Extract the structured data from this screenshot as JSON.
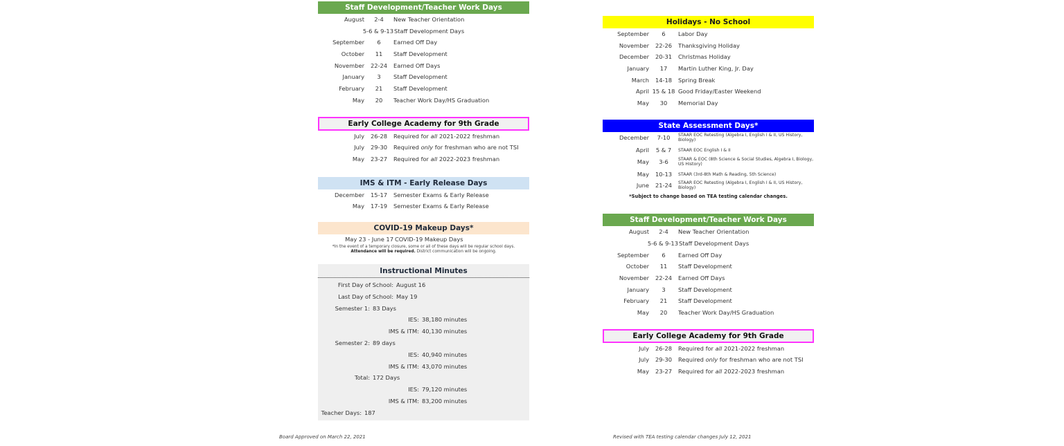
{
  "left_column": {
    "staff_development": {
      "title": "Staff Development/Teacher Work Days",
      "rows": [
        {
          "month": "August",
          "dates": "2-4",
          "event": "New Teacher Orientation"
        },
        {
          "month": "",
          "dates": "5-6 & 9-13",
          "event": "Staff Development Days"
        },
        {
          "month": "September",
          "dates": "6",
          "event": "Earned Off Day"
        },
        {
          "month": "October",
          "dates": "11",
          "event": "Staff Development"
        },
        {
          "month": "November",
          "dates": "22-24",
          "event": "Earned Off Days"
        },
        {
          "month": "January",
          "dates": "3",
          "event": "Staff Development"
        },
        {
          "month": "February",
          "dates": "21",
          "event": "Staff Development"
        },
        {
          "month": "May",
          "dates": "20",
          "event": "Teacher Work Day/HS Graduation"
        }
      ]
    },
    "early_college": {
      "title": "Early College Academy for 9th Grade",
      "rows": [
        {
          "month": "July",
          "dates": "26-28",
          "event_pre": "Required for ",
          "event_em": "all",
          "event_post": " 2021-2022 freshman"
        },
        {
          "month": "July",
          "dates": "29-30",
          "event_pre": "Required ",
          "event_em": "only",
          "event_post": " for freshman who are not TSI"
        },
        {
          "month": "May",
          "dates": "23-27",
          "event_pre": "Required for ",
          "event_em": "all",
          "event_post": " 2022-2023 freshman"
        }
      ]
    },
    "early_release": {
      "title": "IMS & ITM - Early Release Days",
      "rows": [
        {
          "month": "December",
          "dates": "15-17",
          "event": "Semester Exams & Early Release"
        },
        {
          "month": "May",
          "dates": "17-19",
          "event": "Semester Exams & Early Release"
        }
      ]
    },
    "covid": {
      "title": "COVID-19 Makeup Days*",
      "range": "May 23 - June 17",
      "event": "COVID-19 Makeup Days",
      "note_line1": "*In the event of a temporary closure, some or all of these days will be regular school days.",
      "note_bold": "Attendance will be required.",
      "note_line2": " District communication will be ongoing."
    },
    "instructional_minutes": {
      "title": "Instructional Minutes",
      "rows": [
        {
          "label": "First Day of School:",
          "value": "August 16",
          "indent": 1
        },
        {
          "label": "Last Day of School:",
          "value": "May 19",
          "indent": 1
        },
        {
          "label": "Semester 1:",
          "value": "83 Days",
          "indent": 0
        },
        {
          "label": "IES:",
          "value": "38,180 minutes",
          "indent": 2
        },
        {
          "label": "IMS & ITM:",
          "value": "40,130 minutes",
          "indent": 2
        },
        {
          "label": "Semester 2:",
          "value": "89 days",
          "indent": 0
        },
        {
          "label": "IES:",
          "value": "40,940 minutes",
          "indent": 2
        },
        {
          "label": "IMS & ITM:",
          "value": "43,070 minutes",
          "indent": 2
        },
        {
          "label": "Total:",
          "value": "172 Days",
          "indent": 3
        },
        {
          "label": "IES:",
          "value": "79,120 minutes",
          "indent": 2
        },
        {
          "label": "IMS & ITM:",
          "value": "83,200 minutes",
          "indent": 2
        },
        {
          "label": "Teacher Days:",
          "value": "187",
          "indent": 4
        }
      ]
    },
    "footer": "Board Approved on March 22, 2021"
  },
  "right_column": {
    "holidays": {
      "title": "Holidays - No School",
      "rows": [
        {
          "month": "September",
          "dates": "6",
          "event": "Labor Day"
        },
        {
          "month": "November",
          "dates": "22-26",
          "event": "Thanksgiving Holiday"
        },
        {
          "month": "December",
          "dates": "20-31",
          "event": "Christmas Holiday"
        },
        {
          "month": "January",
          "dates": "17",
          "event": "Martin Luther King, Jr. Day"
        },
        {
          "month": "March",
          "dates": "14-18",
          "event": "Spring Break"
        },
        {
          "month": "April",
          "dates": "15 & 18",
          "event": "Good Friday/Easter Weekend"
        },
        {
          "month": "May",
          "dates": "30",
          "event": "Memorial Day"
        }
      ]
    },
    "state_assessment": {
      "title": "State Assessment Days*",
      "rows": [
        {
          "month": "December",
          "dates": "7-10",
          "event": "STAAR EOC Retesting (Algebra I, English I & II, US History, Biology)"
        },
        {
          "month": "April",
          "dates": "5 & 7",
          "event": "STAAR EOC English I & II"
        },
        {
          "month": "May",
          "dates": "3-6",
          "event": "STAAR & EOC (8th Science & Social Studies, Algebra I, Biology, US History)"
        },
        {
          "month": "May",
          "dates": "10-13",
          "event": "STAAR (3rd-8th Math & Reading, 5th Science)"
        },
        {
          "month": "June",
          "dates": "21-24",
          "event": "STAAR EOC Retesting (Algebra I, English I & II, US History, Biology)"
        }
      ],
      "note": "*Subject to change based on TEA testing calendar changes."
    },
    "staff_development": {
      "title": "Staff Development/Teacher Work Days",
      "rows": [
        {
          "month": "August",
          "dates": "2-4",
          "event": "New Teacher Orientation"
        },
        {
          "month": "",
          "dates": "5-6 & 9-13",
          "event": "Staff Development Days"
        },
        {
          "month": "September",
          "dates": "6",
          "event": "Earned Off Day"
        },
        {
          "month": "October",
          "dates": "11",
          "event": "Staff Development"
        },
        {
          "month": "November",
          "dates": "22-24",
          "event": "Earned Off Days"
        },
        {
          "month": "January",
          "dates": "3",
          "event": "Staff Development"
        },
        {
          "month": "February",
          "dates": "21",
          "event": "Staff Development"
        },
        {
          "month": "May",
          "dates": "20",
          "event": "Teacher Work Day/HS Graduation"
        }
      ]
    },
    "early_college": {
      "title": "Early College Academy for 9th Grade",
      "rows": [
        {
          "month": "July",
          "dates": "26-28",
          "event_pre": "Required for ",
          "event_em": "all",
          "event_post": " 2021-2022 freshman"
        },
        {
          "month": "July",
          "dates": "29-30",
          "event_pre": "Required ",
          "event_em": "only",
          "event_post": " for freshman who are not TSI"
        },
        {
          "month": "May",
          "dates": "23-27",
          "event_pre": "Required for ",
          "event_em": "all",
          "event_post": " 2022-2023 freshman"
        }
      ]
    },
    "footer": "Revised with TEA testing calendar changes July 12, 2021"
  },
  "colors": {
    "green_header": "#6aa84f",
    "yellow_header": "#ffff00",
    "blue_header": "#0000ff",
    "lightblue_header": "#cfe2f3",
    "peach_header": "#fce5cd",
    "magenta_border": "#ff33ff",
    "gray_panel": "#efefef"
  }
}
